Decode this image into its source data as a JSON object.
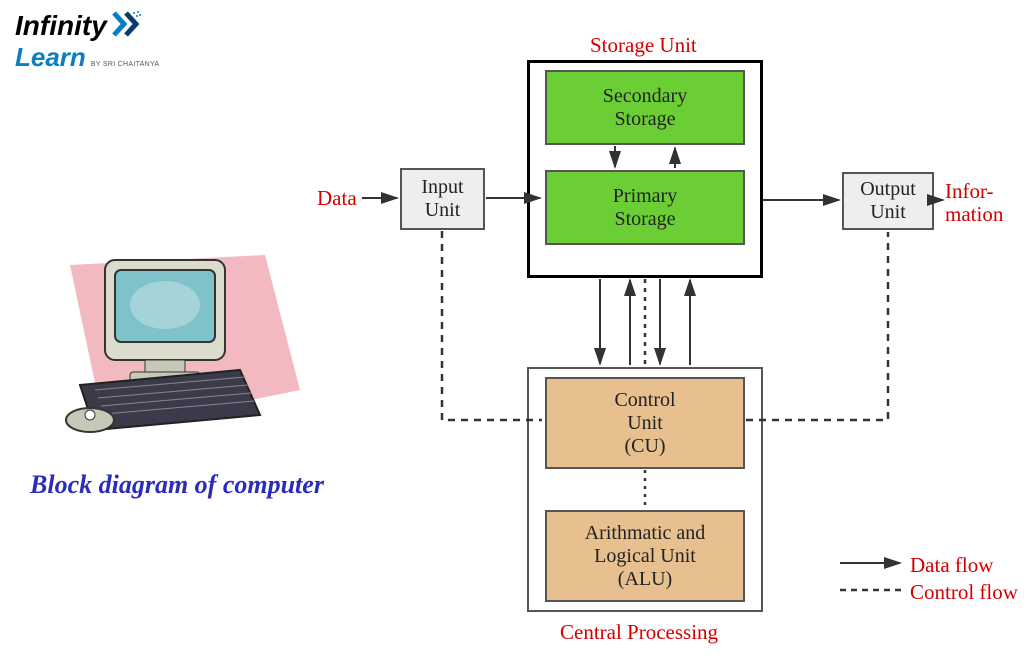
{
  "logo": {
    "line1": "Infinity",
    "line2": "Learn",
    "tagline": "BY SRI CHAITANYA"
  },
  "caption": "Block diagram of computer",
  "labels": {
    "storage_title": "Storage Unit",
    "data": "Data",
    "information": "Infor-\nmation",
    "cpu_title": "Central Processing",
    "data_flow": "Data flow",
    "control_flow": "Control flow"
  },
  "boxes": {
    "input": "Input\nUnit",
    "output": "Output\nUnit",
    "secondary": "Secondary\nStorage",
    "primary": "Primary\nStorage",
    "cu": "Control\nUnit\n(CU)",
    "alu": "Arithmatic and\nLogical Unit\n(ALU)"
  }
}
